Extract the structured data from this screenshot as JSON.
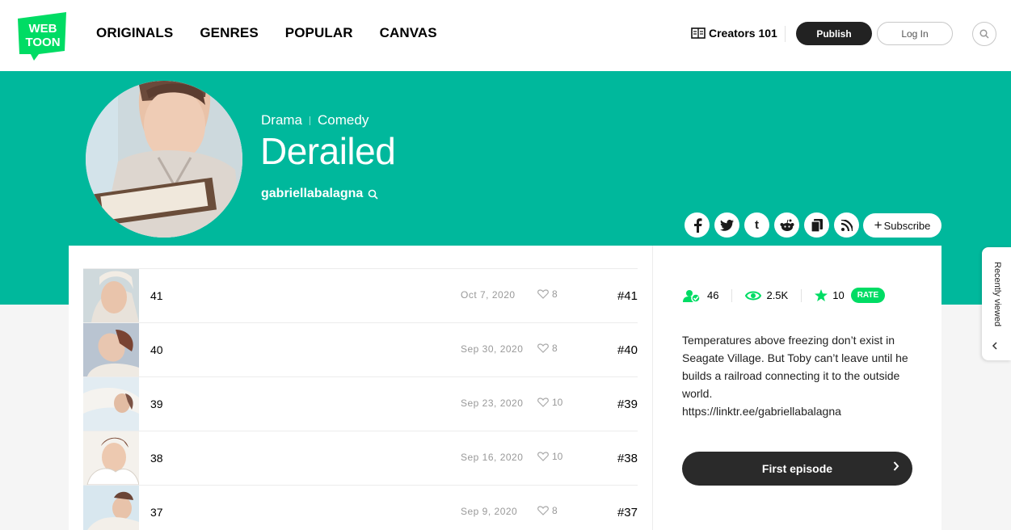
{
  "header": {
    "logo_line1": "WEB",
    "logo_line2": "TOON",
    "nav": [
      "ORIGINALS",
      "GENRES",
      "POPULAR",
      "CANVAS"
    ],
    "creators_label": "Creators 101",
    "publish_label": "Publish",
    "login_label": "Log In"
  },
  "series": {
    "genres": [
      "Drama",
      "Comedy"
    ],
    "title": "Derailed",
    "author": "gabriellabalagna",
    "subscribe_label": "Subscribe"
  },
  "share": [
    "facebook-icon",
    "twitter-icon",
    "tumblr-icon",
    "reddit-icon",
    "copy-link-icon",
    "rss-icon"
  ],
  "episodes": [
    {
      "num": "41",
      "date": "Oct 7, 2020",
      "likes": "8",
      "ep": "#41"
    },
    {
      "num": "40",
      "date": "Sep 30, 2020",
      "likes": "8",
      "ep": "#40"
    },
    {
      "num": "39",
      "date": "Sep 23, 2020",
      "likes": "10",
      "ep": "#39"
    },
    {
      "num": "38",
      "date": "Sep 16, 2020",
      "likes": "10",
      "ep": "#38"
    },
    {
      "num": "37",
      "date": "Sep 9, 2020",
      "likes": "8",
      "ep": "#37"
    }
  ],
  "stats": {
    "subscribers": "46",
    "views": "2.5K",
    "rating": "10",
    "rate_label": "RATE"
  },
  "summary": "Temperatures above freezing don’t exist in Seagate Village. But Toby can’t leave until he builds a railroad connecting it to the outside world.",
  "summary_link": "https://linktr.ee/gabriellabalagna",
  "first_episode_label": "First episode",
  "recently_viewed_label": "Recently viewed",
  "colors": {
    "brand": "#00dc64",
    "banner": "#00b89c",
    "dark": "#222222"
  }
}
